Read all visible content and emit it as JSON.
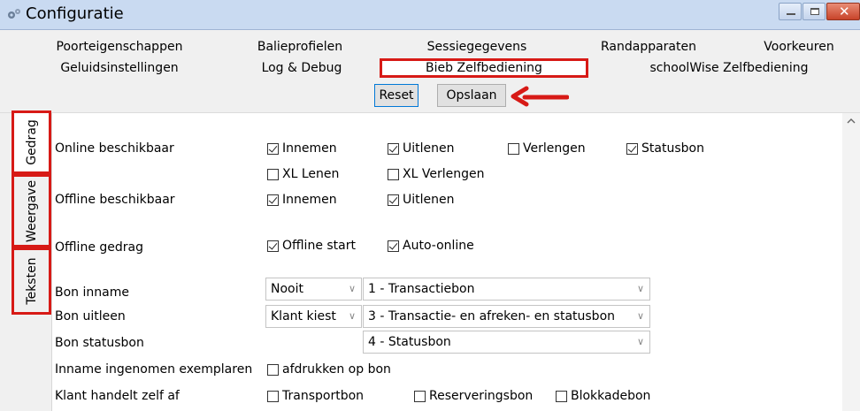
{
  "window": {
    "title": "Configuratie"
  },
  "tabs_row1": [
    "Poorteigenschappen",
    "Balieprofielen",
    "Sessiegegevens",
    "Randapparaten",
    "Voorkeuren"
  ],
  "tabs_row2": [
    "Geluidsinstellingen",
    "Log & Debug",
    "Bieb Zelfbediening",
    "schoolWise Zelfbediening"
  ],
  "toolbar": {
    "reset_label": "Reset",
    "save_label": "Opslaan"
  },
  "side_tabs": [
    "Gedrag",
    "Weergave",
    "Teksten"
  ],
  "rows": {
    "online": "Online beschikbaar",
    "offline": "Offline beschikbaar",
    "offline_gedrag": "Offline gedrag",
    "bon_inname": "Bon inname",
    "bon_uitleen": "Bon uitleen",
    "bon_statusbon": "Bon statusbon",
    "inname_ingenomen": "Inname ingenomen exemplaren",
    "klant_handelt": "Klant handelt zelf af"
  },
  "checkboxes": {
    "online_innemen": "Innemen",
    "online_uitlenen": "Uitlenen",
    "online_verlengen": "Verlengen",
    "online_statusbon": "Statusbon",
    "online_xl_lenen": "XL Lenen",
    "online_xl_verlengen": "XL Verlengen",
    "offline_innemen": "Innemen",
    "offline_uitlenen": "Uitlenen",
    "offline_start": "Offline start",
    "auto_online": "Auto-online",
    "afdrukken": "afdrukken op bon",
    "transportbon": "Transportbon",
    "reserveringsbon": "Reserveringsbon",
    "blokkadebon": "Blokkadebon"
  },
  "selects": {
    "inname_when": "Nooit",
    "inname_type": "1 - Transactiebon",
    "uitleen_when": "Klant kiest",
    "uitleen_type": "3 - Transactie- en afreken- en statusbon",
    "statusbon_type": "4 - Statusbon"
  },
  "colors": {
    "highlight": "#d71a16",
    "titlebar": "#c9daf1"
  }
}
